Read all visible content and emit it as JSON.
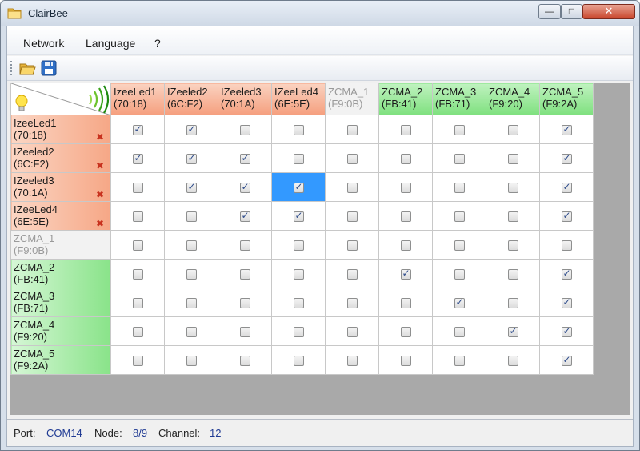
{
  "window": {
    "title": "ClairBee",
    "minimize": "—",
    "maximize": "□",
    "close": "✕"
  },
  "menu": {
    "items": [
      "Network",
      "Language",
      "?"
    ]
  },
  "toolbar": {
    "open_icon": "folder-open-icon",
    "save_icon": "floppy-disk-icon"
  },
  "colors": {
    "led": "#f6a786",
    "zcma": "#89e389",
    "offline": "#f2f2f2",
    "selected": "#3399ff"
  },
  "matrix": {
    "corner_icons": [
      "lightbulb-icon",
      "signal-waves-icon"
    ],
    "columns": [
      {
        "name": "IzeeLed1",
        "addr": "(70:18)",
        "kind": "led"
      },
      {
        "name": "IZeeled2",
        "addr": "(6C:F2)",
        "kind": "led"
      },
      {
        "name": "IZeeled3",
        "addr": "(70:1A)",
        "kind": "led"
      },
      {
        "name": "IZeeLed4",
        "addr": "(6E:5E)",
        "kind": "led"
      },
      {
        "name": "ZCMA_1",
        "addr": "(F9:0B)",
        "kind": "gray"
      },
      {
        "name": "ZCMA_2",
        "addr": "(FB:41)",
        "kind": "zcma"
      },
      {
        "name": "ZCMA_3",
        "addr": "(FB:71)",
        "kind": "zcma"
      },
      {
        "name": "ZCMA_4",
        "addr": "(F9:20)",
        "kind": "zcma"
      },
      {
        "name": "ZCMA_5",
        "addr": "(F9:2A)",
        "kind": "zcma"
      }
    ],
    "rows": [
      {
        "name": "IzeeLed1",
        "addr": "(70:18)",
        "kind": "led",
        "remove": "✖",
        "checks": [
          1,
          1,
          0,
          0,
          0,
          0,
          0,
          0,
          1
        ]
      },
      {
        "name": "IZeeled2",
        "addr": "(6C:F2)",
        "kind": "led",
        "remove": "✖",
        "checks": [
          1,
          1,
          1,
          0,
          0,
          0,
          0,
          0,
          1
        ]
      },
      {
        "name": "IZeeled3",
        "addr": "(70:1A)",
        "kind": "led",
        "remove": "✖",
        "checks": [
          0,
          1,
          1,
          1,
          0,
          0,
          0,
          0,
          1
        ],
        "selected": 3
      },
      {
        "name": "IZeeLed4",
        "addr": "(6E:5E)",
        "kind": "led",
        "remove": "✖",
        "checks": [
          0,
          0,
          1,
          1,
          0,
          0,
          0,
          0,
          1
        ]
      },
      {
        "name": "ZCMA_1",
        "addr": "(F9:0B)",
        "kind": "gray",
        "remove": "",
        "checks": [
          0,
          0,
          0,
          0,
          0,
          0,
          0,
          0,
          0
        ]
      },
      {
        "name": "ZCMA_2",
        "addr": "(FB:41)",
        "kind": "zcma",
        "remove": "",
        "checks": [
          0,
          0,
          0,
          0,
          0,
          1,
          0,
          0,
          1
        ]
      },
      {
        "name": "ZCMA_3",
        "addr": "(FB:71)",
        "kind": "zcma",
        "remove": "",
        "checks": [
          0,
          0,
          0,
          0,
          0,
          0,
          1,
          0,
          1
        ]
      },
      {
        "name": "ZCMA_4",
        "addr": "(F9:20)",
        "kind": "zcma",
        "remove": "",
        "checks": [
          0,
          0,
          0,
          0,
          0,
          0,
          0,
          1,
          1
        ]
      },
      {
        "name": "ZCMA_5",
        "addr": "(F9:2A)",
        "kind": "zcma",
        "remove": "",
        "checks": [
          0,
          0,
          0,
          0,
          0,
          0,
          0,
          0,
          1
        ]
      }
    ]
  },
  "status": {
    "port_label": "Port:",
    "port_value": "COM14",
    "node_label": "Node:",
    "node_value": "8/9",
    "channel_label": "Channel:",
    "channel_value": "12"
  }
}
